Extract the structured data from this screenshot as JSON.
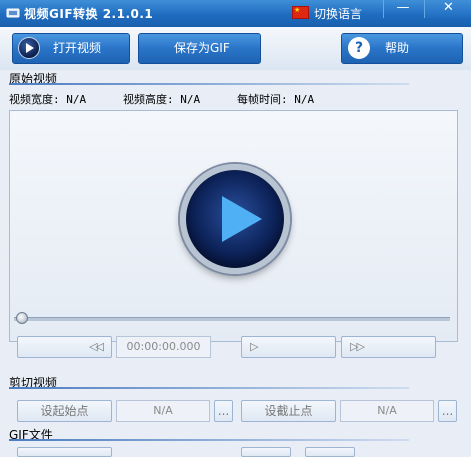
{
  "window": {
    "title": "视频GIF转换 2.1.0.1",
    "language_label": "切换语言",
    "minimize_glyph": "—",
    "close_glyph": "✕"
  },
  "toolbar": {
    "open_label": "打开视频",
    "save_gif_label": "保存为GIF",
    "help_label": "帮助",
    "help_glyph": "?"
  },
  "source": {
    "section_title": "原始视频",
    "width_label": "视频宽度: N/A",
    "height_label": "视频高度: N/A",
    "frame_time_label": "每帧时间: N/A",
    "playback_position": 0,
    "time_display": "00:00:00.000",
    "rewind_glyph": "◁◁",
    "play_glyph": "▷",
    "forward_glyph": "▷▷"
  },
  "cut": {
    "section_title": "剪切视频",
    "set_start_label": "设起始点",
    "start_value": "N/A",
    "set_end_label": "设截止点",
    "end_value": "N/A",
    "ellipsis": "..."
  },
  "gif": {
    "section_title": "GIF文件"
  },
  "colors": {
    "titlebar": "#1f6cc0",
    "toolbar_button": "#2a74c8",
    "play_arrow": "#4fb0f5",
    "background": "#e9eef6"
  }
}
